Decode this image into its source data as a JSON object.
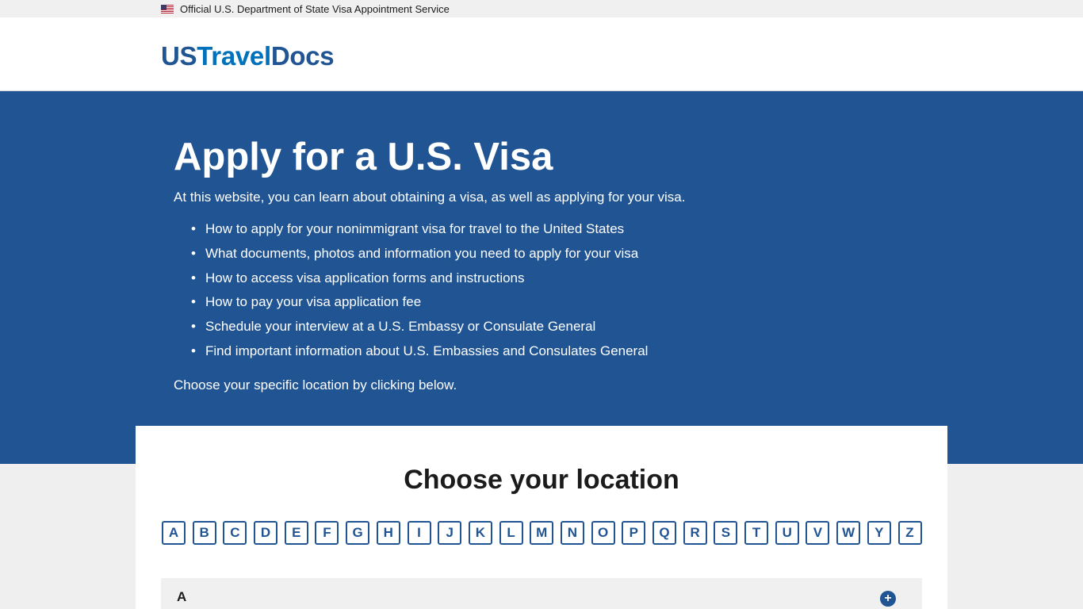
{
  "gov_banner": {
    "text": "Official U.S. Department of State Visa Appointment Service",
    "flag_icon": "us-flag-icon"
  },
  "header": {
    "logo_part1": "US",
    "logo_part2": "Travel",
    "logo_part3": "Docs"
  },
  "hero": {
    "title": "Apply for a U.S. Visa",
    "intro": "At this website, you can learn about obtaining a visa, as well as applying for your visa.",
    "items": [
      "How to apply for your nonimmigrant visa for travel to the United States",
      "What documents, photos and information you need to apply for your visa",
      "How to access visa application forms and instructions",
      "How to pay your visa application fee",
      "Schedule your interview at a U.S. Embassy or Consulate General",
      "Find important information about U.S. Embassies and Consulates General"
    ],
    "choose_text": "Choose your specific location by clicking below."
  },
  "location": {
    "title": "Choose your location",
    "letters": [
      "A",
      "B",
      "C",
      "D",
      "E",
      "F",
      "G",
      "H",
      "I",
      "J",
      "K",
      "L",
      "M",
      "N",
      "O",
      "P",
      "Q",
      "R",
      "S",
      "T",
      "U",
      "V",
      "W",
      "Y",
      "Z"
    ],
    "accordion": {
      "label": "A",
      "icon": "plus-circle-icon"
    }
  },
  "colors": {
    "primary": "#205493",
    "logo_accent": "#0071bb",
    "banner_bg": "#f0f0f0",
    "page_bg": "#efefef"
  }
}
